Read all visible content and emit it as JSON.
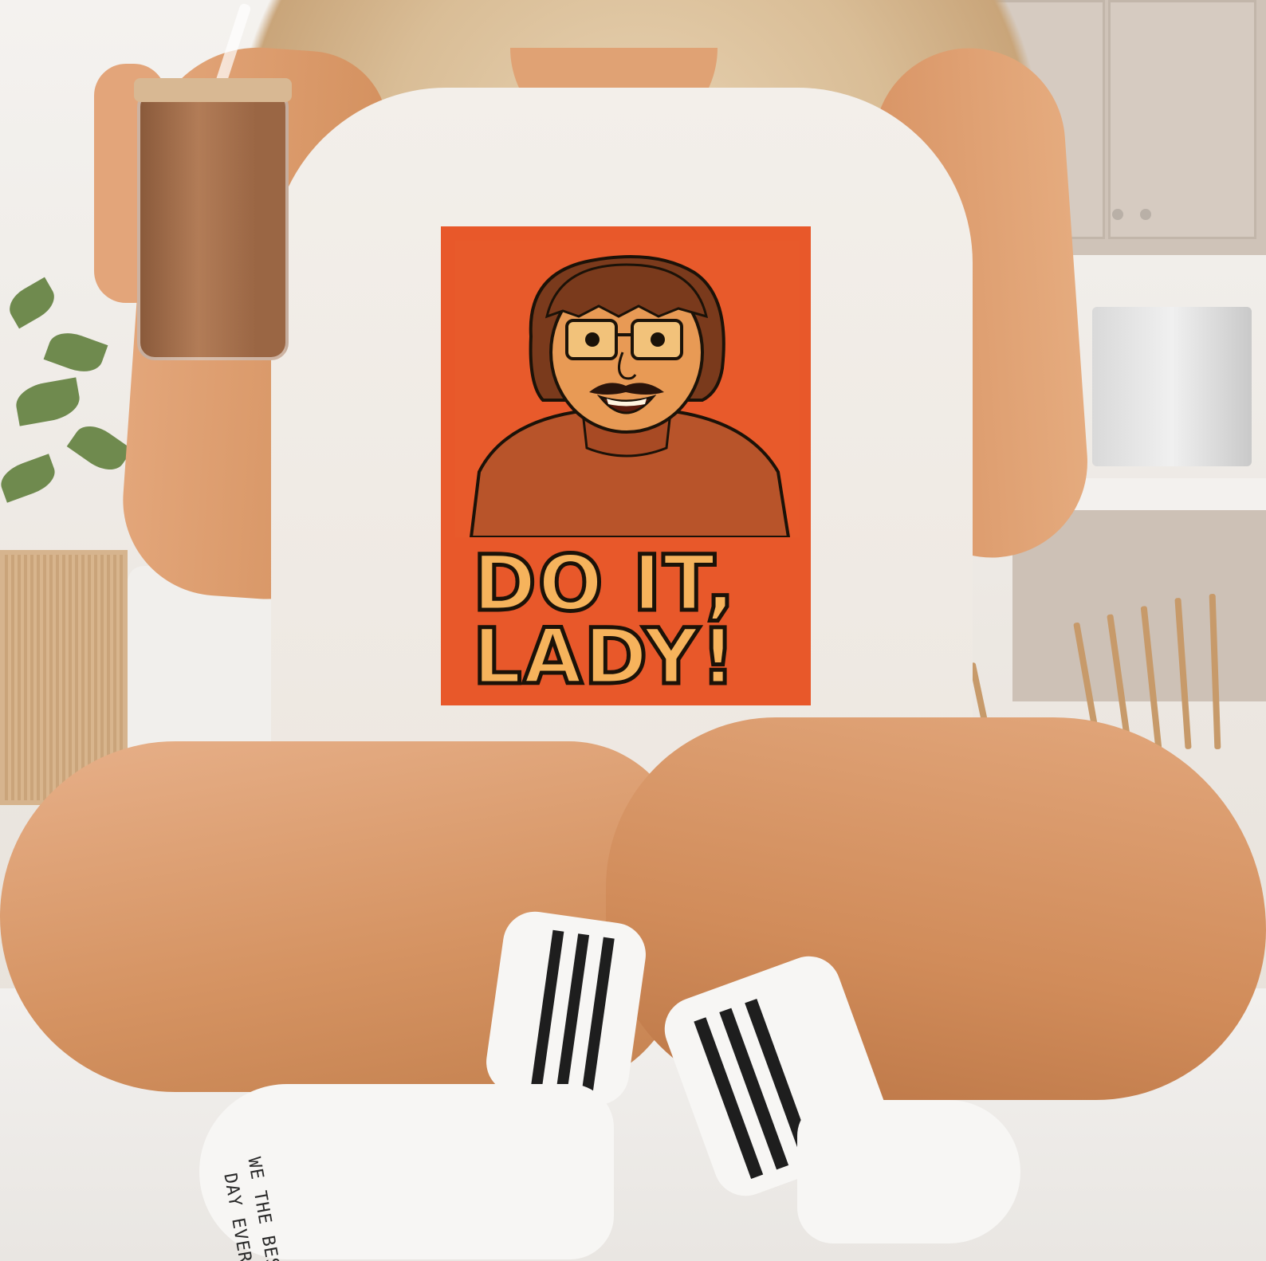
{
  "graphic": {
    "line1": "DO IT,",
    "line2": "LADY!"
  },
  "sock": {
    "line1": "WE THE BEST",
    "line2": "DAY EVER"
  },
  "colors": {
    "graphic_bg": "#e8582a",
    "graphic_text": "#f6b35c",
    "outline": "#1b1208",
    "shirt": "#f0ebe5"
  }
}
